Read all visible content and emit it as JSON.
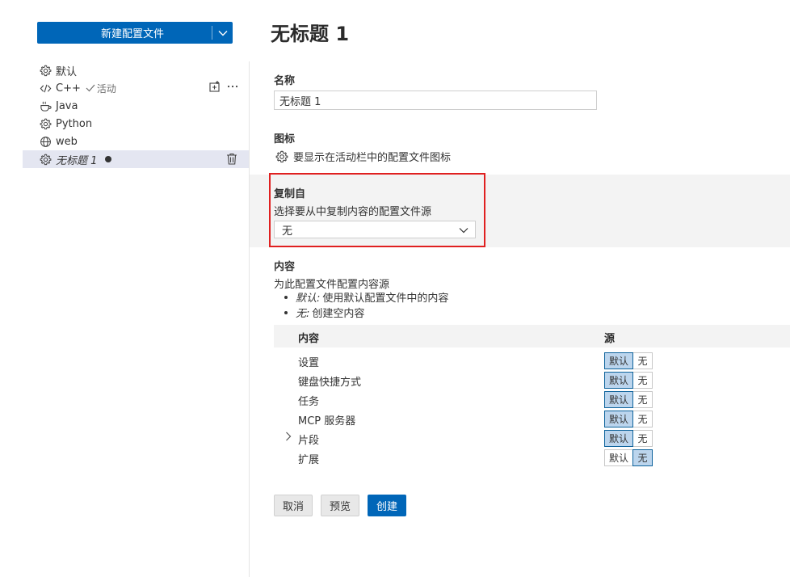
{
  "sidebar": {
    "new_profile_label": "新建配置文件",
    "profiles": [
      {
        "name": "默认",
        "icon": "gear-icon"
      },
      {
        "name": "C++",
        "icon": "code-icon",
        "active_label": "活动"
      },
      {
        "name": "Java",
        "icon": "coffee-icon"
      },
      {
        "name": "Python",
        "icon": "gear-icon"
      },
      {
        "name": "web",
        "icon": "globe-icon"
      },
      {
        "name": "无标题 1",
        "icon": "gear-icon"
      }
    ]
  },
  "editor": {
    "title": "无标题 1",
    "name_section": {
      "label": "名称",
      "value": "无标题 1"
    },
    "icon_section": {
      "label": "图标",
      "description": "要显示在活动栏中的配置文件图标"
    },
    "copy_from": {
      "label": "复制自",
      "description": "选择要从中复制内容的配置文件源",
      "selected": "无"
    },
    "contents": {
      "label": "内容",
      "description": "为此配置文件配置内容源",
      "bullets": [
        {
          "term": "默认:",
          "text": "使用默认配置文件中的内容"
        },
        {
          "term": "无:",
          "text": "创建空内容"
        }
      ],
      "header_content": "内容",
      "header_source": "源",
      "option_default": "默认",
      "option_none": "无",
      "rows": [
        {
          "name": "设置",
          "selected": "default"
        },
        {
          "name": "键盘快捷方式",
          "selected": "default"
        },
        {
          "name": "任务",
          "selected": "default"
        },
        {
          "name": "MCP 服务器",
          "selected": "default"
        },
        {
          "name": "片段",
          "selected": "default",
          "expandable": true
        },
        {
          "name": "扩展",
          "selected": "none"
        }
      ]
    },
    "buttons": {
      "cancel": "取消",
      "preview": "预览",
      "create": "创建"
    }
  },
  "colors": {
    "accent": "#0066b8",
    "highlight": "#e02020",
    "selected_bg": "#e4e6f1"
  }
}
